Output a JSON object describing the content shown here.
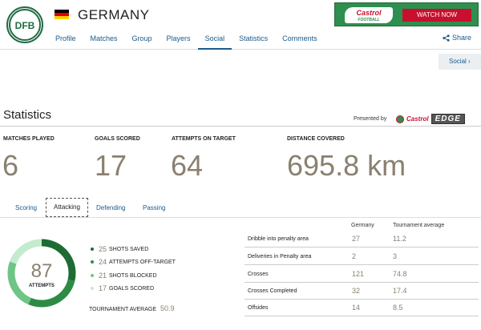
{
  "header": {
    "team_name": "GERMANY",
    "nav": [
      "Profile",
      "Matches",
      "Group",
      "Players",
      "Social",
      "Statistics",
      "Comments"
    ],
    "active_nav": "Social",
    "share_label": "Share",
    "flag_colors": [
      "#000000",
      "#dd0000",
      "#ffce00"
    ]
  },
  "ad": {
    "brand": "Castrol",
    "brand_sub": "FOOTBALL",
    "button": "WATCH NOW"
  },
  "social_tab": "Social ›",
  "statistics": {
    "title": "Statistics",
    "presented_by": "Presented by",
    "sponsor": "Castrol",
    "sponsor_product": "EDGE"
  },
  "summary": [
    {
      "label": "MATCHES PLAYED",
      "value": "6"
    },
    {
      "label": "GOALS SCORED",
      "value": "17"
    },
    {
      "label": "ATTEMPTS ON TARGET",
      "value": "64"
    },
    {
      "label": "DISTANCE COVERED",
      "value": "695.8 km"
    }
  ],
  "subtabs": [
    "Scoring",
    "Attacking",
    "Defending",
    "Passing"
  ],
  "active_subtab": "Attacking",
  "attempts": {
    "total": "87",
    "label": "ATTEMPTS",
    "breakdown": [
      {
        "value": 25,
        "label": "Shots saved",
        "color": "#1e6b34"
      },
      {
        "value": 24,
        "label": "Attempts off-target",
        "color": "#2e8b45"
      },
      {
        "value": 21,
        "label": "Shots blocked",
        "color": "#6fc586"
      },
      {
        "value": 17,
        "label": "Goals scored",
        "color": "#c3ebcd"
      }
    ],
    "tournament_average_label": "TOURNAMENT AVERAGE",
    "tournament_average": "50.9"
  },
  "table": {
    "columns": [
      "Germany",
      "Tournament average"
    ],
    "rows": [
      {
        "label": "Dribble into penalty area",
        "team": "27",
        "avg": "11.2"
      },
      {
        "label": "Deliveries in Penalty area",
        "team": "2",
        "avg": "3"
      },
      {
        "label": "Crosses",
        "team": "121",
        "avg": "74.8"
      },
      {
        "label": "Crosses Completed",
        "team": "32",
        "avg": "17.4"
      },
      {
        "label": "Offsides",
        "team": "14",
        "avg": "8.5"
      }
    ]
  }
}
